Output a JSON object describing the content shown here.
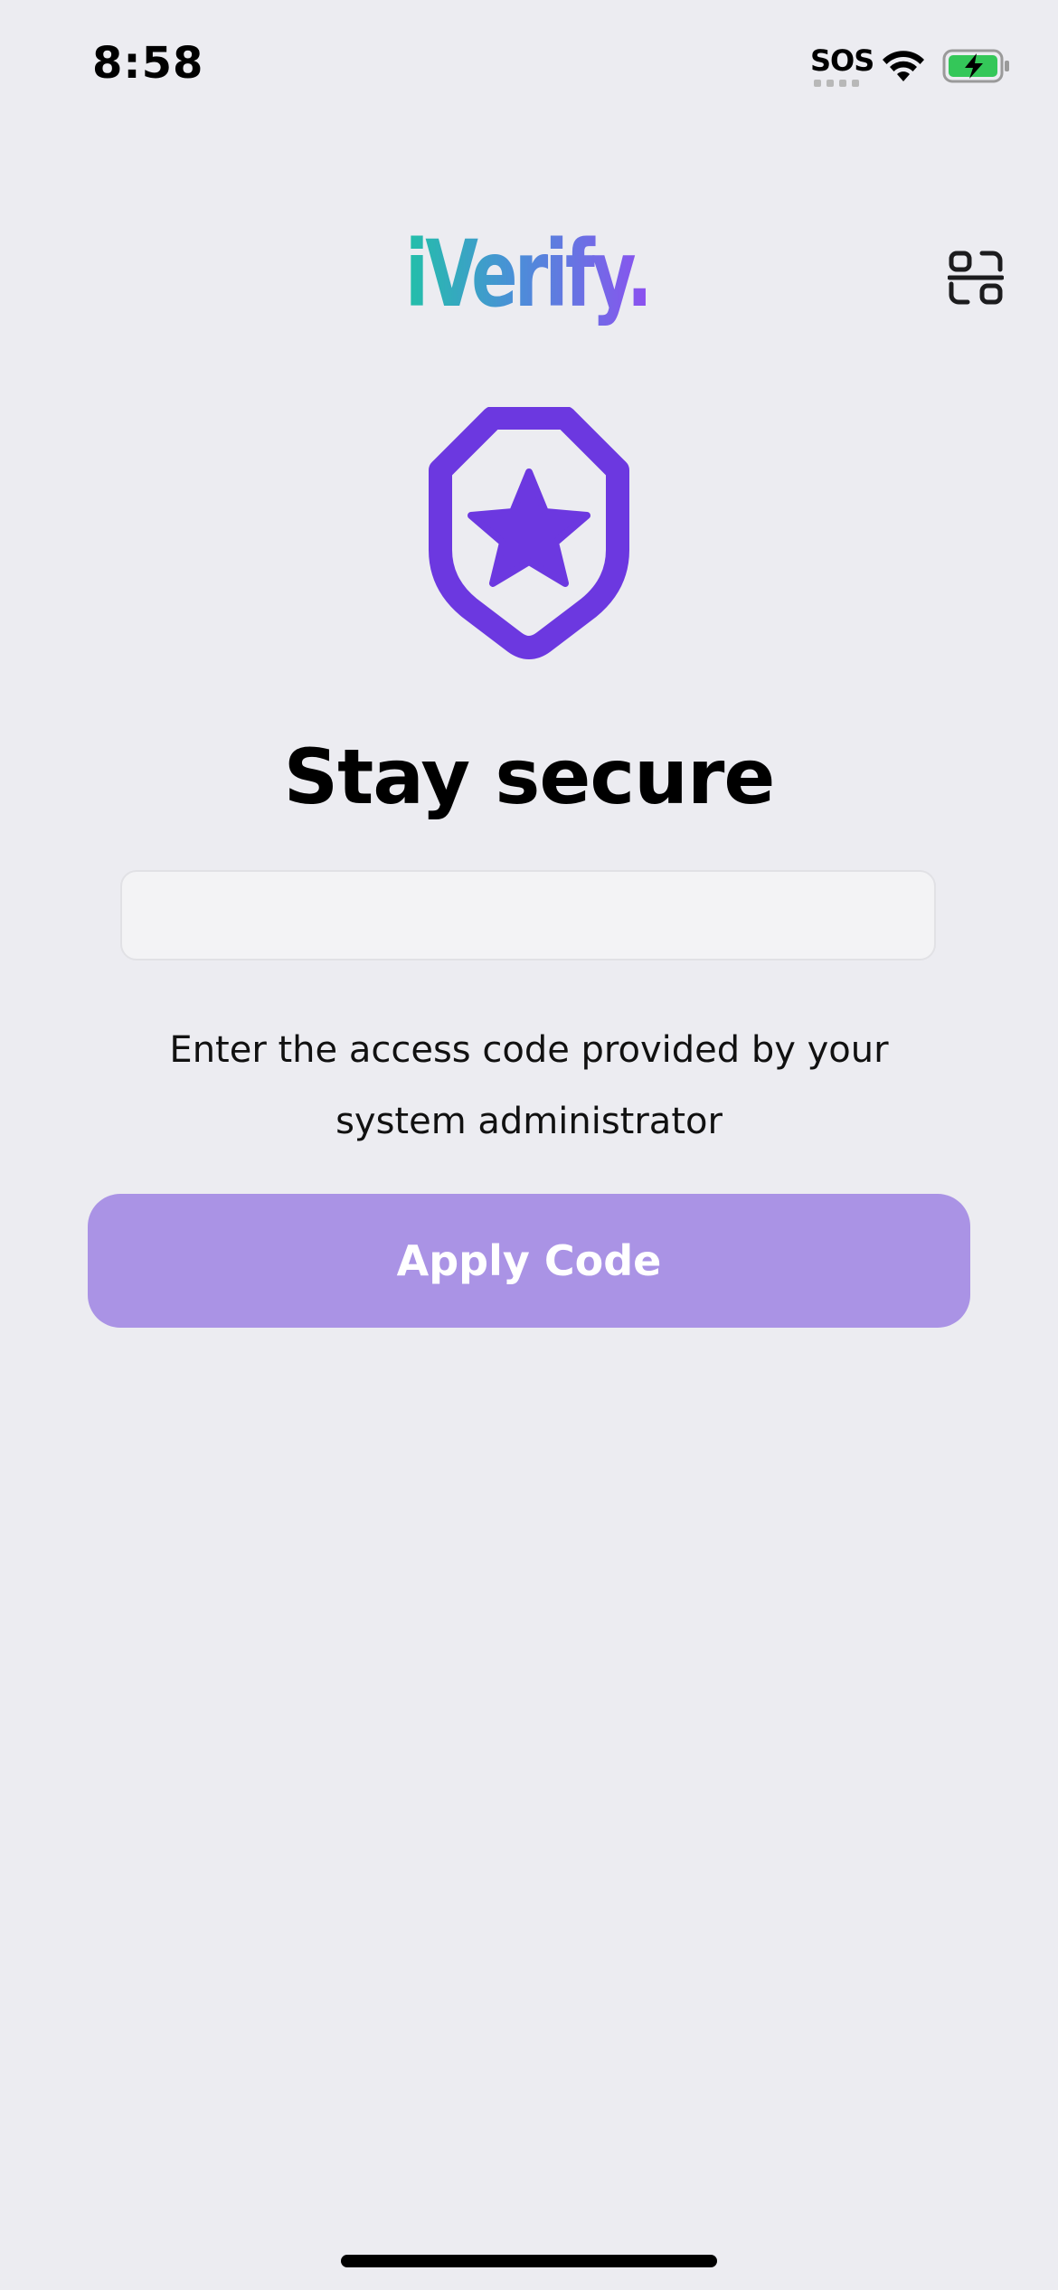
{
  "status_bar": {
    "time": "8:58",
    "sos_label": "SOS",
    "icons": [
      "cellular-sos-icon",
      "wifi-icon",
      "battery-charging-icon"
    ],
    "battery_color": "#34C759"
  },
  "header": {
    "logo_text": "iVerify.",
    "logo_gradient": [
      "#22C0A8",
      "#4A8FD8",
      "#8D50F0"
    ],
    "scan_icon": "qr-scan-icon"
  },
  "main": {
    "hero_icon": "shield-star-icon",
    "hero_color": "#6C38E0",
    "title": "Stay secure",
    "code_input": {
      "value": "",
      "placeholder": ""
    },
    "hint": "Enter the access code provided by your system administrator",
    "apply_button": {
      "label": "Apply Code",
      "color": "#AA93E5"
    }
  }
}
